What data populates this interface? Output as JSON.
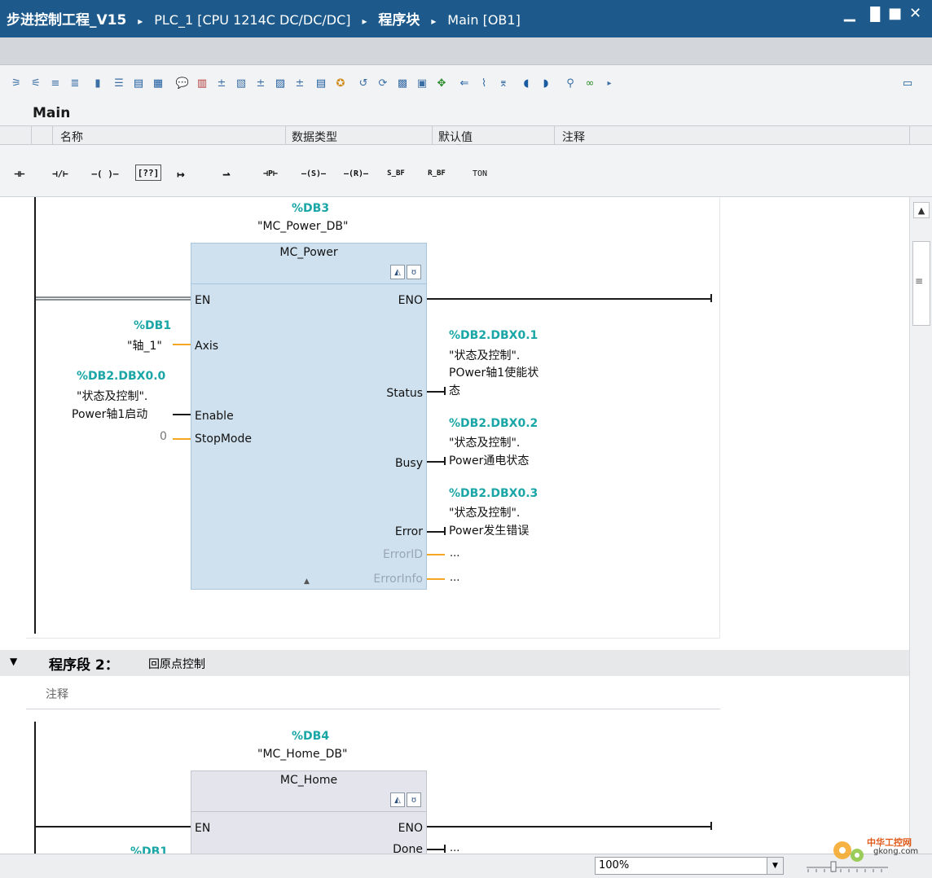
{
  "window": {
    "title_parts": [
      "步进控制工程_V15",
      "PLC_1 [CPU 1214C DC/DC/DC]",
      "程序块",
      "Main [OB1]"
    ],
    "separator": "▸",
    "controls": [
      "minimize-icon",
      "restore-icon",
      "maximize-icon",
      "close-icon"
    ]
  },
  "block": {
    "name": "Main"
  },
  "interface": {
    "columns": [
      "名称",
      "数据类型",
      "默认值",
      "注释"
    ]
  },
  "instructions": [
    "⊣⊢",
    "⊣/⊢",
    "–( )–",
    "[??]",
    "↦",
    "⇀",
    "⊣P⊢",
    "–(S)–",
    "–(R)–",
    "S_BF",
    "R_BF",
    "TON"
  ],
  "network1": {
    "instance_db_addr": "%DB3",
    "instance_db_name": "\"MC_Power_DB\"",
    "block_title": "MC_Power",
    "in_pins": [
      "EN",
      "Axis",
      "Enable",
      "StopMode"
    ],
    "out_pins": [
      "ENO",
      "Status",
      "Busy",
      "Error",
      "ErrorID",
      "ErrorInfo"
    ],
    "axis_addr": "%DB1",
    "axis_name": "\"轴_1\"",
    "enable_addr": "%DB2.DBX0.0",
    "enable_line1": "\"状态及控制\".",
    "enable_line2": "Power轴1启动",
    "stopmode_val": "0",
    "status_addr": "%DB2.DBX0.1",
    "status_line1": "\"状态及控制\".",
    "status_line2": "POwer轴1使能状",
    "status_line3": "态",
    "busy_addr": "%DB2.DBX0.2",
    "busy_line1": "\"状态及控制\".",
    "busy_line2": "Power通电状态",
    "error_addr": "%DB2.DBX0.3",
    "error_line1": "\"状态及控制\".",
    "error_line2": "Power发生错误",
    "errorid_val": "...",
    "errorinfo_val": "..."
  },
  "network2": {
    "title": "程序段 2：",
    "subtitle": "回原点控制",
    "comment": "注释",
    "instance_db_addr": "%DB4",
    "instance_db_name": "\"MC_Home_DB\"",
    "block_title": "MC_Home",
    "in_pins": [
      "EN"
    ],
    "out_pins": [
      "ENO",
      "Done"
    ],
    "axis_addr": "%DB1",
    "done_val": "..."
  },
  "statusbar": {
    "zoom": "100%"
  },
  "watermark": {
    "text1": "中华工控网",
    "text2": "gkong.com"
  }
}
